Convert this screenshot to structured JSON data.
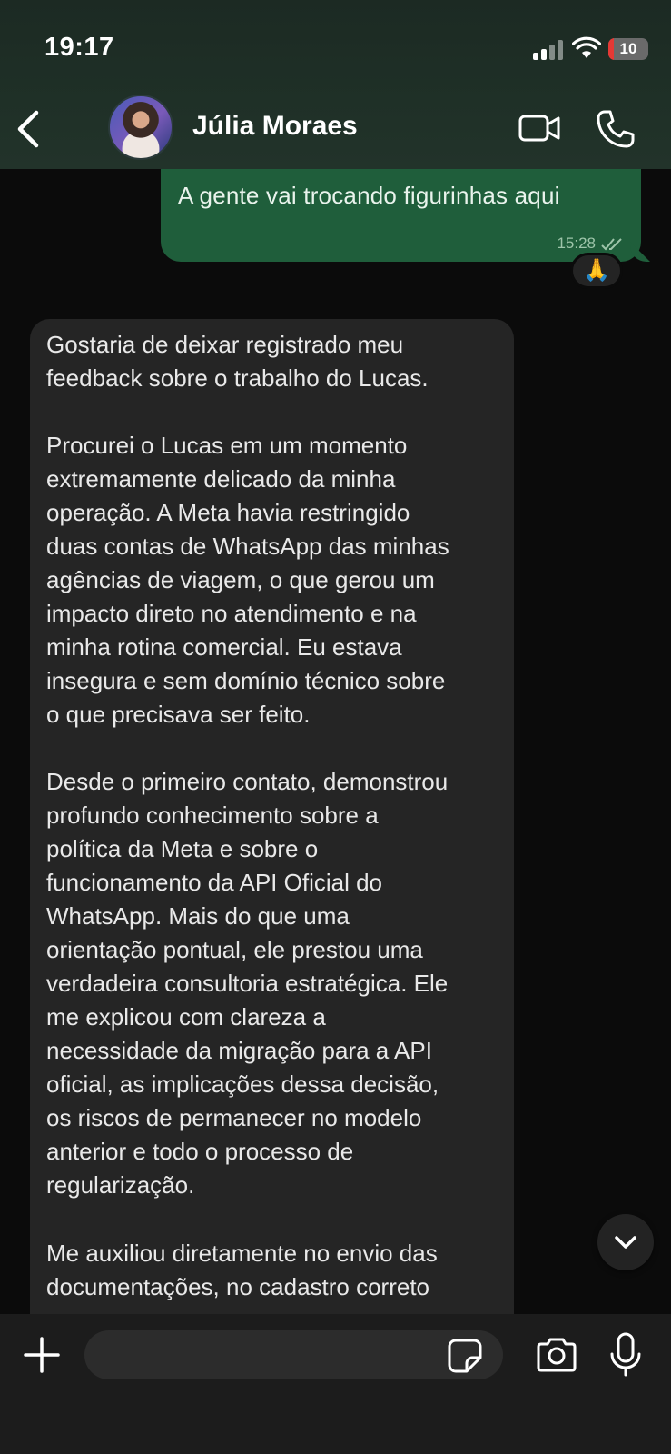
{
  "status_bar": {
    "time": "19:17",
    "battery": "10",
    "icons": [
      "signal-icon",
      "wifi-icon",
      "battery-icon"
    ]
  },
  "header": {
    "contact_name": "Júlia Moraes",
    "icons": [
      "back-arrow-icon",
      "video-call-icon",
      "phone-call-icon"
    ]
  },
  "messages": {
    "outgoing": {
      "text": "A gente vai trocando figurinhas aqui",
      "time": "15:28",
      "status_icon": "double-check-icon",
      "reaction": "🙏"
    },
    "incoming": {
      "paragraphs": [
        "Gostaria de deixar registrado meu\nfeedback sobre o trabalho do Lucas.",
        "Procurei o Lucas em um momento\nextremamente delicado da minha\noperação. A Meta havia restringido\nduas contas de WhatsApp das minhas\nagências de viagem, o que gerou um\nimpacto direto no atendimento e na\nminha rotina comercial. Eu estava\ninsegura e sem domínio técnico sobre\no que precisava ser feito.",
        "Desde o primeiro contato, demonstrou\nprofundo conhecimento sobre a\npolítica da Meta e sobre o\nfuncionamento da API Oficial do\nWhatsApp. Mais do que uma\norientação pontual, ele prestou uma\nverdadeira consultoria estratégica. Ele\nme explicou com clareza a\nnecessidade da migração para a API\noficial, as implicações dessa decisão,\nos riscos de permanecer no modelo\nanterior e todo o processo de\nregularização.",
        "Me auxiliou diretamente no envio das\ndocumentações, no cadastro correto"
      ]
    }
  },
  "input_bar": {
    "placeholder": "",
    "icons": [
      "plus-icon",
      "sticker-icon",
      "camera-icon",
      "microphone-icon"
    ]
  },
  "colors": {
    "outgoing_bubble": "#1f5e3b",
    "incoming_bubble": "#252525",
    "header_bg": "#1f3027",
    "background": "#0b0b0b"
  }
}
